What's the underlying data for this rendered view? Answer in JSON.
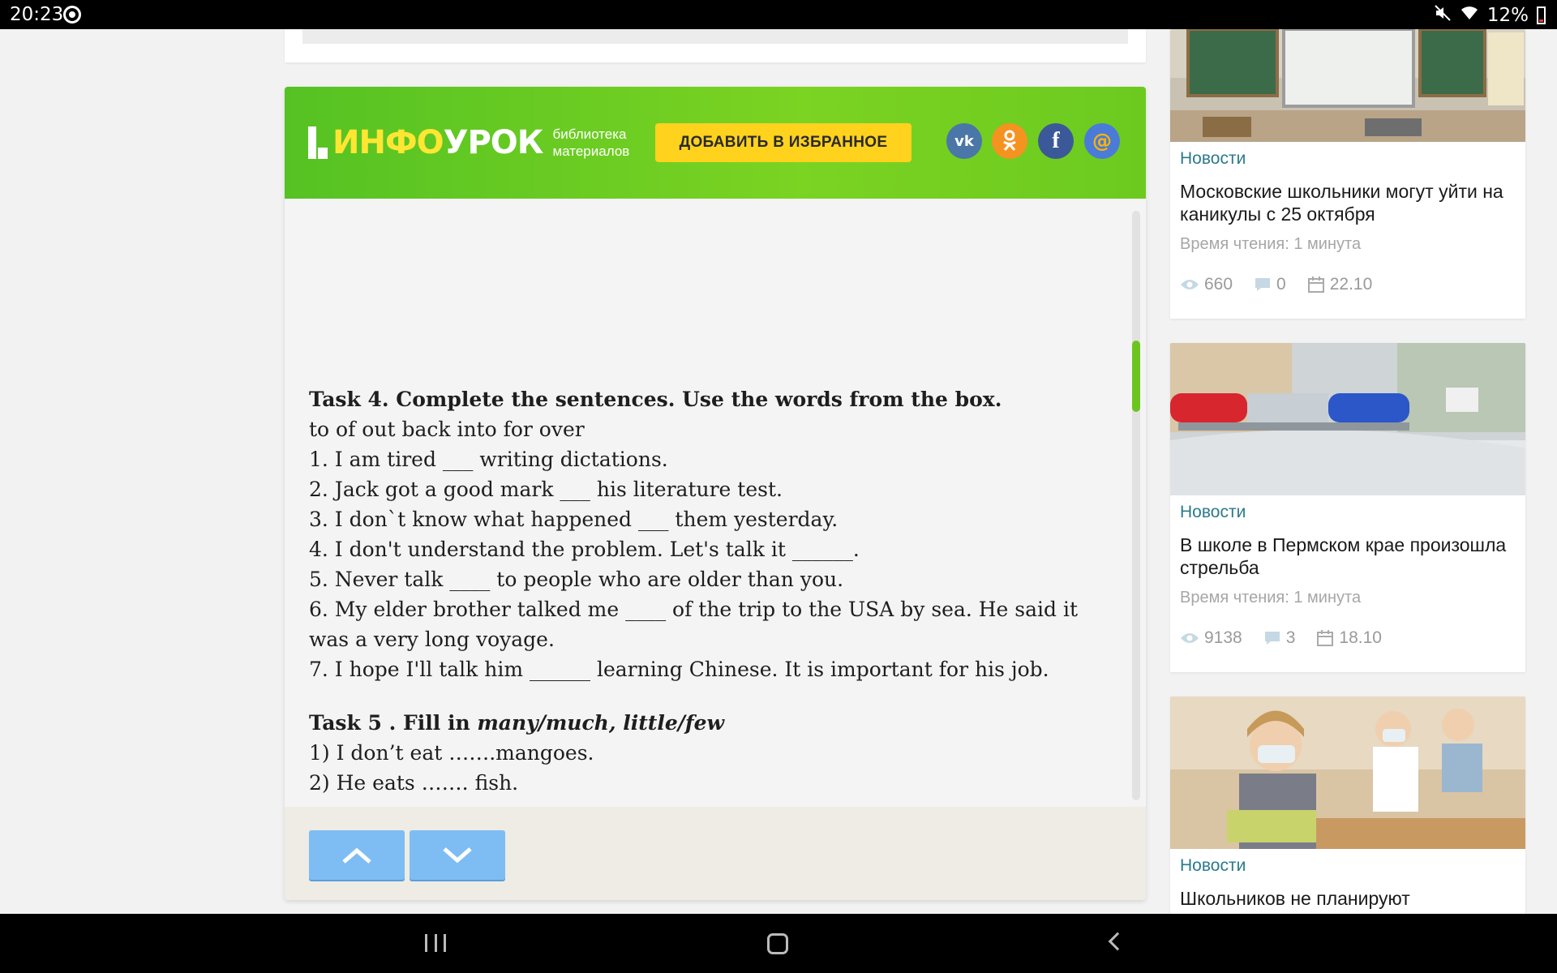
{
  "status_bar": {
    "time": "20:23",
    "battery": "12%"
  },
  "banner": {
    "logo_yellow": "ИНФО",
    "logo_white": "УРОК",
    "logo_sub_1": "библиотека",
    "logo_sub_2": "материалов",
    "favorite_label": "ДОБАВИТЬ В ИЗБРАННОЕ",
    "social": {
      "vk": "vk",
      "ok": "ok",
      "fb": "f",
      "mail": "@"
    }
  },
  "document": {
    "task4_heading": "Task 4. Complete the sentences. Use the words from the box.",
    "task4_words": "to of out back into for over",
    "task4_lines": [
      "1. I am tired ___ writing dictations.",
      "2. Jack got a good mark ___ his literature test.",
      "3. I don`t know what happened ___ them yesterday.",
      "4. I don't understand the problem. Let's talk it ______.",
      "5. Never talk ____ to people who are older than you.",
      "6. My elder brother talked me ____ of the trip to the USA by sea. He said it",
      "was a very long voyage.",
      "7. I hope I'll talk him ______ learning Chinese. It is important for his job."
    ],
    "task5_heading_plain": "Task 5 . Fill in ",
    "task5_heading_italic": "many/much, little/few",
    "task5_lines": [
      "1) I don’t eat …….mangoes.",
      "2) He eats ……. fish."
    ]
  },
  "news": [
    {
      "category": "Новости",
      "title": "Московские школьники могут уйти на каникулы с 25 октября",
      "reading_time": "Время чтения: 1 минута",
      "views": "660",
      "comments": "0",
      "date": "22.10"
    },
    {
      "category": "Новости",
      "title": "В школе в Пермском крае произошла стрельба",
      "reading_time": "Время чтения: 1 минута",
      "views": "9138",
      "comments": "3",
      "date": "18.10"
    },
    {
      "category": "Новости",
      "title": "Школьников не планируют"
    }
  ],
  "colors": {
    "banner_green": "#6cca1f",
    "logo_yellow": "#ffe633",
    "favorite_button": "#ffd21e",
    "nav_button": "#7dbdf3",
    "news_category": "#2b7a8c",
    "scroll_thumb": "#6cc51f"
  },
  "icons": {
    "status": [
      "sync-icon",
      "mute-icon",
      "wifi-icon",
      "battery-icon"
    ],
    "news_meta": [
      "eye-icon",
      "comment-icon",
      "calendar-icon"
    ],
    "navigation": [
      "chevron-up-icon",
      "chevron-down-icon",
      "recent-apps-icon",
      "home-icon",
      "back-icon"
    ]
  }
}
